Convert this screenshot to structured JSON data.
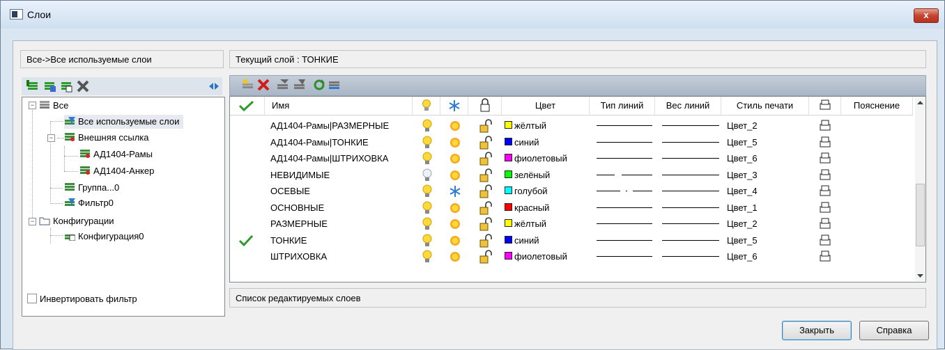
{
  "window": {
    "title": "Слои",
    "close_glyph": "x"
  },
  "left_panel": {
    "filter_title": "Все->Все используемые слои",
    "tree_toolbar_icons": [
      "new-filter-icon",
      "new-group-icon",
      "new-config-icon",
      "delete-icon",
      "toggle-panel-icon"
    ],
    "tree": {
      "root": "Все",
      "all_used": "Все используемые слои",
      "xref": "Внешняя ссылка",
      "xref_child1": "АД1404-Рамы",
      "xref_child2": "АД1404-Анкер",
      "group": "Группа...0",
      "filter": "Фильтр0",
      "configs": "Конфигурации",
      "config0": "Конфигурация0"
    },
    "invert_label": "Инвертировать фильтр"
  },
  "right_panel": {
    "current_layer": "Текущий слой : ТОНКИЕ",
    "toolbar_icons": [
      "new-layer-icon",
      "delete-layer-icon",
      "filter-icon",
      "filter-clear-icon",
      "refresh-icon",
      "layer-states-icon"
    ],
    "columns": {
      "name": "Имя",
      "color": "Цвет",
      "linetype": "Тип линий",
      "lineweight": "Вес линий",
      "plotstyle": "Стиль печати",
      "description": "Пояснение"
    },
    "rows": [
      {
        "current": false,
        "name": "АД1404-Рамы|РАЗМЕРНЫЕ",
        "on": true,
        "frozen": false,
        "color_name": "жёлтый",
        "color": "#ffff00",
        "linetype": "solid",
        "plot_style": "Цвет_2"
      },
      {
        "current": false,
        "name": "АД1404-Рамы|ТОНКИЕ",
        "on": true,
        "frozen": false,
        "color_name": "синий",
        "color": "#0000ff",
        "linetype": "solid",
        "plot_style": "Цвет_5"
      },
      {
        "current": false,
        "name": "АД1404-Рамы|ШТРИХОВКА",
        "on": true,
        "frozen": false,
        "color_name": "фиолетовый",
        "color": "#ff00ff",
        "linetype": "solid",
        "plot_style": "Цвет_6"
      },
      {
        "current": false,
        "name": "НЕВИДИМЫЕ",
        "on": false,
        "frozen": false,
        "color_name": "зелёный",
        "color": "#00ff00",
        "linetype": "dashed",
        "plot_style": "Цвет_3"
      },
      {
        "current": false,
        "name": "ОСЕВЫЕ",
        "on": true,
        "frozen": true,
        "color_name": "голубой",
        "color": "#00ffff",
        "linetype": "dashdot",
        "plot_style": "Цвет_4"
      },
      {
        "current": false,
        "name": "ОСНОВНЫЕ",
        "on": true,
        "frozen": false,
        "color_name": "красный",
        "color": "#ff0000",
        "linetype": "solid",
        "plot_style": "Цвет_1"
      },
      {
        "current": false,
        "name": "РАЗМЕРНЫЕ",
        "on": true,
        "frozen": false,
        "color_name": "жёлтый",
        "color": "#ffff00",
        "linetype": "solid",
        "plot_style": "Цвет_2"
      },
      {
        "current": true,
        "name": "ТОНКИЕ",
        "on": true,
        "frozen": false,
        "color_name": "синий",
        "color": "#0000ff",
        "linetype": "solid",
        "plot_style": "Цвет_5"
      },
      {
        "current": false,
        "name": "ШТРИХОВКА",
        "on": true,
        "frozen": false,
        "color_name": "фиолетовый",
        "color": "#ff00ff",
        "linetype": "solid",
        "plot_style": "Цвет_6"
      }
    ],
    "status": "Список редактируемых слоев"
  },
  "buttons": {
    "close": "Закрыть",
    "help": "Справка"
  }
}
